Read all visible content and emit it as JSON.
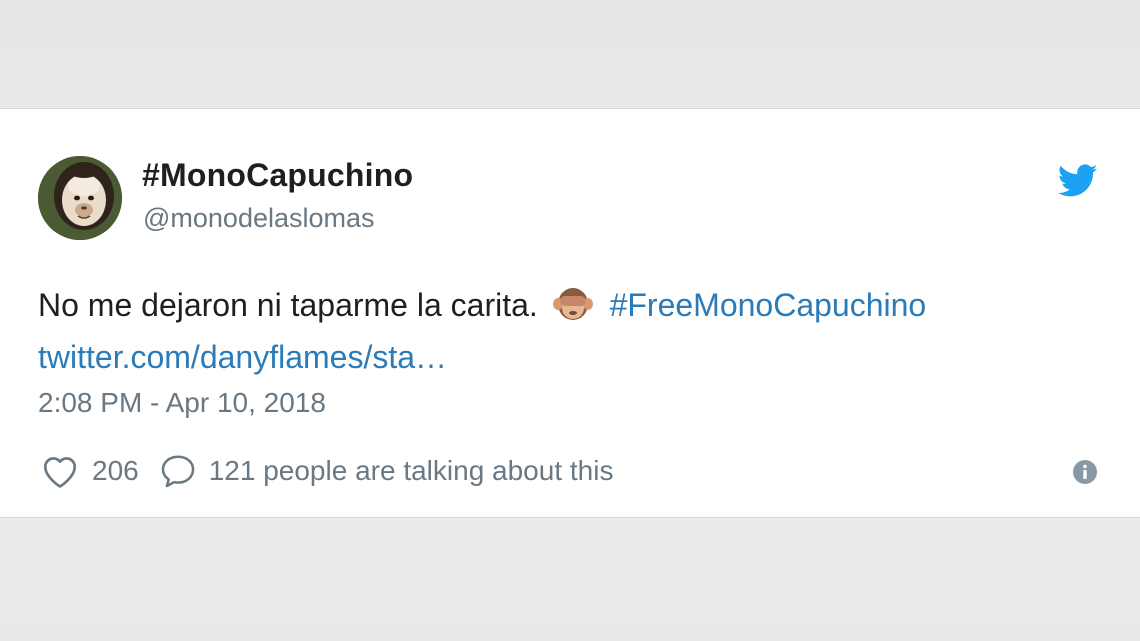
{
  "tweet": {
    "display_name": "#MonoCapuchino",
    "handle": "@monodelaslomas",
    "text_main": "No me dejaron ni taparme la carita.",
    "emoji_name": "see-no-evil-monkey-icon",
    "hashtag": "#FreeMonoCapuchino",
    "link": "twitter.com/danyflames/sta…",
    "timestamp": "2:08 PM - Apr 10, 2018",
    "like_count": "206",
    "reply_text": "121 people are talking about this"
  },
  "colors": {
    "twitter_blue": "#1da1f2",
    "link_blue": "#2b7bb9",
    "text_dark": "#1c2022",
    "text_gray": "#697882"
  },
  "icons": {
    "brand": "twitter-bird-icon",
    "like": "heart-icon",
    "reply": "speech-bubble-icon",
    "info": "info-icon"
  }
}
